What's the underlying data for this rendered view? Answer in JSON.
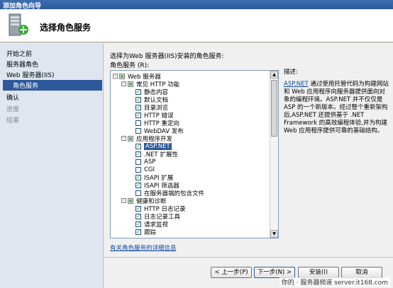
{
  "window": {
    "title": "添加角色向导"
  },
  "header": {
    "title": "选择角色服务",
    "icon": "server-add-icon"
  },
  "nav": {
    "items": [
      {
        "label": "开始之前",
        "state": "normal"
      },
      {
        "label": "服务器角色",
        "state": "normal"
      },
      {
        "label": "Web 服务器(IIS)",
        "state": "normal"
      },
      {
        "label": "角色服务",
        "state": "selected"
      },
      {
        "label": "确认",
        "state": "normal"
      },
      {
        "label": "进度",
        "state": "disabled"
      },
      {
        "label": "结果",
        "state": "disabled"
      }
    ]
  },
  "main": {
    "instruction": "选择为Web 服务器(IIS)安装的角色服务:",
    "list_label": "角色服务 (R):",
    "tree": [
      {
        "label": "Web 服务器",
        "level": 0,
        "expander": "-",
        "check": "indet"
      },
      {
        "label": "常见 HTTP 功能",
        "level": 1,
        "expander": "-",
        "check": "indet"
      },
      {
        "label": "静态内容",
        "level": 2,
        "check": "checked"
      },
      {
        "label": "默认文档",
        "level": 2,
        "check": "checked"
      },
      {
        "label": "目录浏览",
        "level": 2,
        "check": "checked"
      },
      {
        "label": "HTTP 错误",
        "level": 2,
        "check": "checked"
      },
      {
        "label": "HTTP 重定向",
        "level": 2,
        "check": "unchecked"
      },
      {
        "label": "WebDAV 发布",
        "level": 2,
        "check": "unchecked"
      },
      {
        "label": "应用程序开发",
        "level": 1,
        "expander": "-",
        "check": "indet"
      },
      {
        "label": "ASP.NET",
        "level": 2,
        "check": "checked",
        "selected": true
      },
      {
        "label": ".NET 扩展性",
        "level": 2,
        "check": "checked"
      },
      {
        "label": "ASP",
        "level": 2,
        "check": "unchecked"
      },
      {
        "label": "CGI",
        "level": 2,
        "check": "unchecked"
      },
      {
        "label": "ISAPI 扩展",
        "level": 2,
        "check": "checked"
      },
      {
        "label": "ISAPI 筛选器",
        "level": 2,
        "check": "checked"
      },
      {
        "label": "在服务器端的包含文件",
        "level": 2,
        "check": "unchecked"
      },
      {
        "label": "健康和诊断",
        "level": 1,
        "expander": "-",
        "check": "indet"
      },
      {
        "label": "HTTP 日志记录",
        "level": 2,
        "check": "checked"
      },
      {
        "label": "日志记录工具",
        "level": 2,
        "check": "checked"
      },
      {
        "label": "请求监视",
        "level": 2,
        "check": "checked"
      },
      {
        "label": "跟踪",
        "level": 2,
        "check": "checked"
      }
    ],
    "description_label": "描述:",
    "description_link": "ASP.NET",
    "description_text": "通过使用托管代码为构建网站和 Web 应用程序向服务器提供面向对象的编程环境。ASP.NET 并不仅仅是 ASP 的一个新版本。经过整个重新架构后,ASP.NET 还提供基于 .NET Framework 的高效编程体验,并为构建 Web 应用程序提供可靠的基础结构。",
    "more_link": "有关角色服务的详细信息"
  },
  "buttons": {
    "prev": "< 上一步(P)",
    "next": "下一步(N) >",
    "install": "安装(I)",
    "cancel": "取消"
  },
  "watermark": "你的 · 服务器频道 server.it168.com"
}
